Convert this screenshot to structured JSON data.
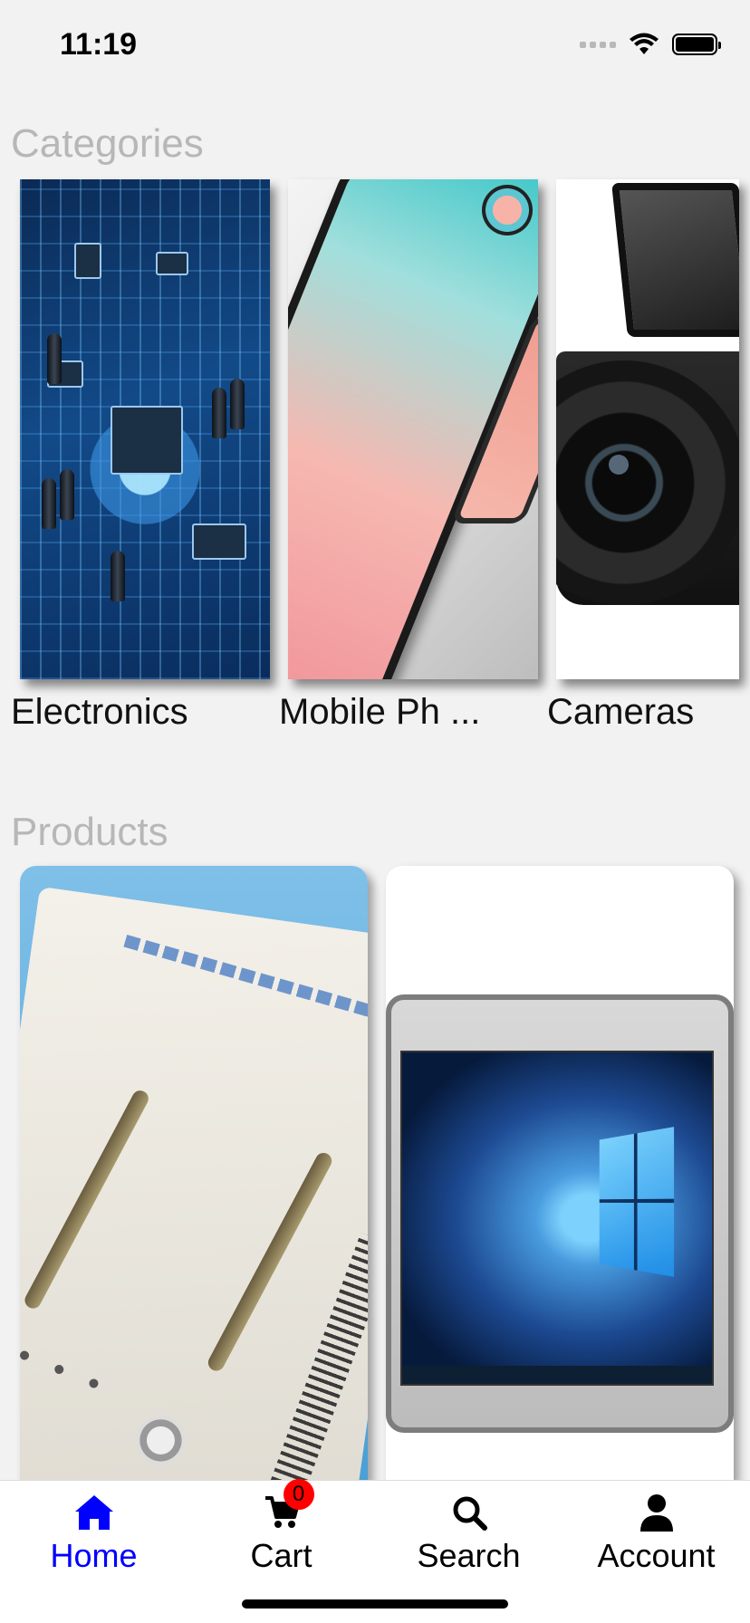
{
  "status_bar": {
    "time": "11:19"
  },
  "sections": {
    "categories_title": "Categories",
    "products_title": "Products"
  },
  "categories": [
    {
      "label": "Electronics",
      "image": "circuit-board-image"
    },
    {
      "label": "Mobile Ph ...",
      "image": "tablet-phone-image"
    },
    {
      "label": "Cameras",
      "image": "camera-image"
    }
  ],
  "products": [
    {
      "image": "device-programmer-image"
    },
    {
      "image": "windows-tablet-image"
    }
  ],
  "tab_bar": {
    "home": "Home",
    "cart": "Cart",
    "cart_badge": "0",
    "search": "Search",
    "account": "Account"
  },
  "colors": {
    "active_tab": "#0000ff",
    "badge": "#ff0000",
    "section_title": "#b7b7b7"
  }
}
